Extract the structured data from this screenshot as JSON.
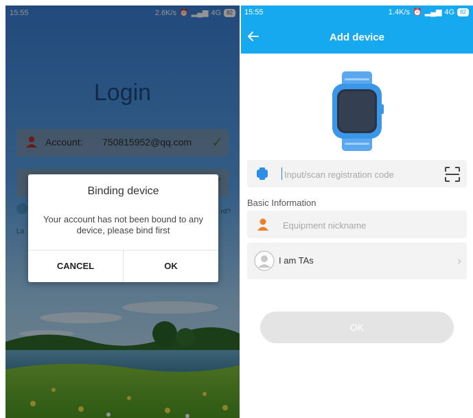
{
  "left_screen": {
    "status": {
      "time": "15:55",
      "speed": "2.6K/s",
      "network": "4G",
      "battery": "82"
    },
    "title": "Login",
    "account": {
      "label": "Account:",
      "value": "750815952@qq.com"
    },
    "dialog": {
      "title": "Binding device",
      "message": "Your account has not been bound to any device, please bind first",
      "cancel_label": "CANCEL",
      "ok_label": "OK"
    },
    "snippets": {
      "language_fragment": "La",
      "forgot_fragment": "rd?"
    }
  },
  "right_screen": {
    "status": {
      "time": "15:55",
      "speed": "1.4K/s",
      "network": "4G",
      "battery": "82"
    },
    "header_title": "Add device",
    "registration": {
      "placeholder": "Input/scan registration code"
    },
    "section_label": "Basic Information",
    "nickname": {
      "placeholder": "Equipment nickname"
    },
    "role": {
      "label": "I am TAs"
    },
    "ok_label": "OK"
  },
  "colors": {
    "header_blue": "#17a9f0",
    "watch_blue": "#3a96e8",
    "nickname_icon_orange": "#f07d2a",
    "ok_disabled": "#e4e4e4"
  }
}
